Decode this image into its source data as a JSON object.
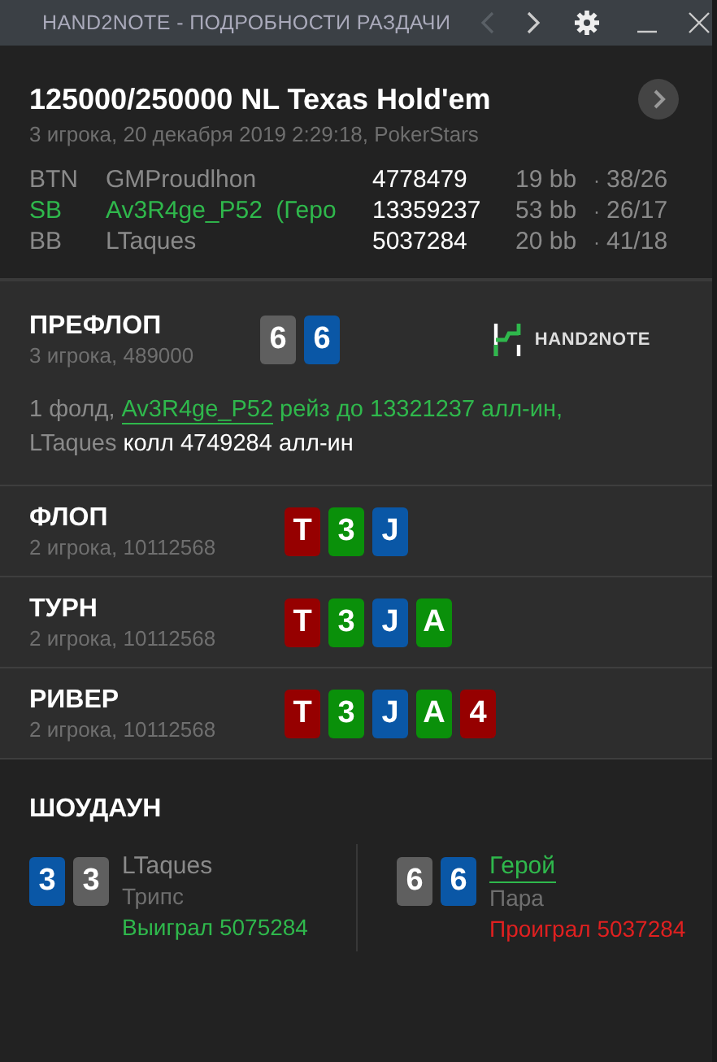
{
  "window": {
    "title": "HAND2NOTE - ПОДРОБНОСТИ РАЗДАЧИ",
    "back_disabled": true
  },
  "hand": {
    "title": "125000/250000 NL Texas Hold'em",
    "subtitle": "3 игрока, 20 декабря 2019 2:29:18, PokerStars",
    "players": [
      {
        "position": "BTN",
        "name": "GMProudlhon",
        "hero": false,
        "stack": "4778479",
        "bb": "19 bb",
        "sep": "·",
        "stats": "38/26"
      },
      {
        "position": "SB",
        "name": "Av3R4ge_P52",
        "suffix": "(Геро",
        "hero": true,
        "stack": "13359237",
        "bb": "53 bb",
        "sep": "·",
        "stats": "26/17"
      },
      {
        "position": "BB",
        "name": "LTaques",
        "hero": false,
        "stack": "5037284",
        "bb": "20 bb",
        "sep": "·",
        "stats": "41/18"
      }
    ]
  },
  "streets": [
    {
      "name": "ПРЕФЛОП",
      "info": "3 игрока, 489000",
      "logo": "HAND2NOTE",
      "cards": [
        {
          "rank": "6",
          "color": "#5f5f5f"
        },
        {
          "rank": "6",
          "color": "#0a57a6"
        }
      ],
      "action": [
        [
          {
            "kind": "muted",
            "text": "1 фолд, "
          },
          {
            "kind": "hero",
            "text": "Av3R4ge_P52"
          },
          {
            "kind": "green",
            "text": " рейз до 13321237 алл-ин,"
          }
        ],
        [
          {
            "kind": "muted",
            "text": "LTaques"
          },
          {
            "kind": "plain",
            "text": " колл 4749284 алл-ин"
          }
        ]
      ]
    },
    {
      "name": "ФЛОП",
      "info": "2 игрока, 10112568",
      "cards": [
        {
          "rank": "T",
          "color": "#960000"
        },
        {
          "rank": "3",
          "color": "#0a900a"
        },
        {
          "rank": "J",
          "color": "#0a57a6"
        }
      ]
    },
    {
      "name": "ТУРН",
      "info": "2 игрока, 10112568",
      "cards": [
        {
          "rank": "T",
          "color": "#960000"
        },
        {
          "rank": "3",
          "color": "#0a900a"
        },
        {
          "rank": "J",
          "color": "#0a57a6"
        },
        {
          "rank": "A",
          "color": "#0a900a"
        }
      ]
    },
    {
      "name": "РИВЕР",
      "info": "2 игрока, 10112568",
      "cards": [
        {
          "rank": "T",
          "color": "#960000"
        },
        {
          "rank": "3",
          "color": "#0a900a"
        },
        {
          "rank": "J",
          "color": "#0a57a6"
        },
        {
          "rank": "A",
          "color": "#0a900a"
        },
        {
          "rank": "4",
          "color": "#960000"
        }
      ]
    }
  ],
  "showdown": {
    "title": "ШОУДАУН",
    "players": [
      {
        "name": "LTaques",
        "hero": false,
        "hand": "Трипс",
        "won": true,
        "result": "Выиграл 5075284",
        "cards": [
          {
            "rank": "3",
            "color": "#0a57a6"
          },
          {
            "rank": "3",
            "color": "#5f5f5f"
          }
        ]
      },
      {
        "name": "Герой",
        "hero": true,
        "hand": "Пара",
        "won": false,
        "result": "Проиграл 5037284",
        "cards": [
          {
            "rank": "6",
            "color": "#5f5f5f"
          },
          {
            "rank": "6",
            "color": "#0a57a6"
          }
        ]
      }
    ]
  }
}
